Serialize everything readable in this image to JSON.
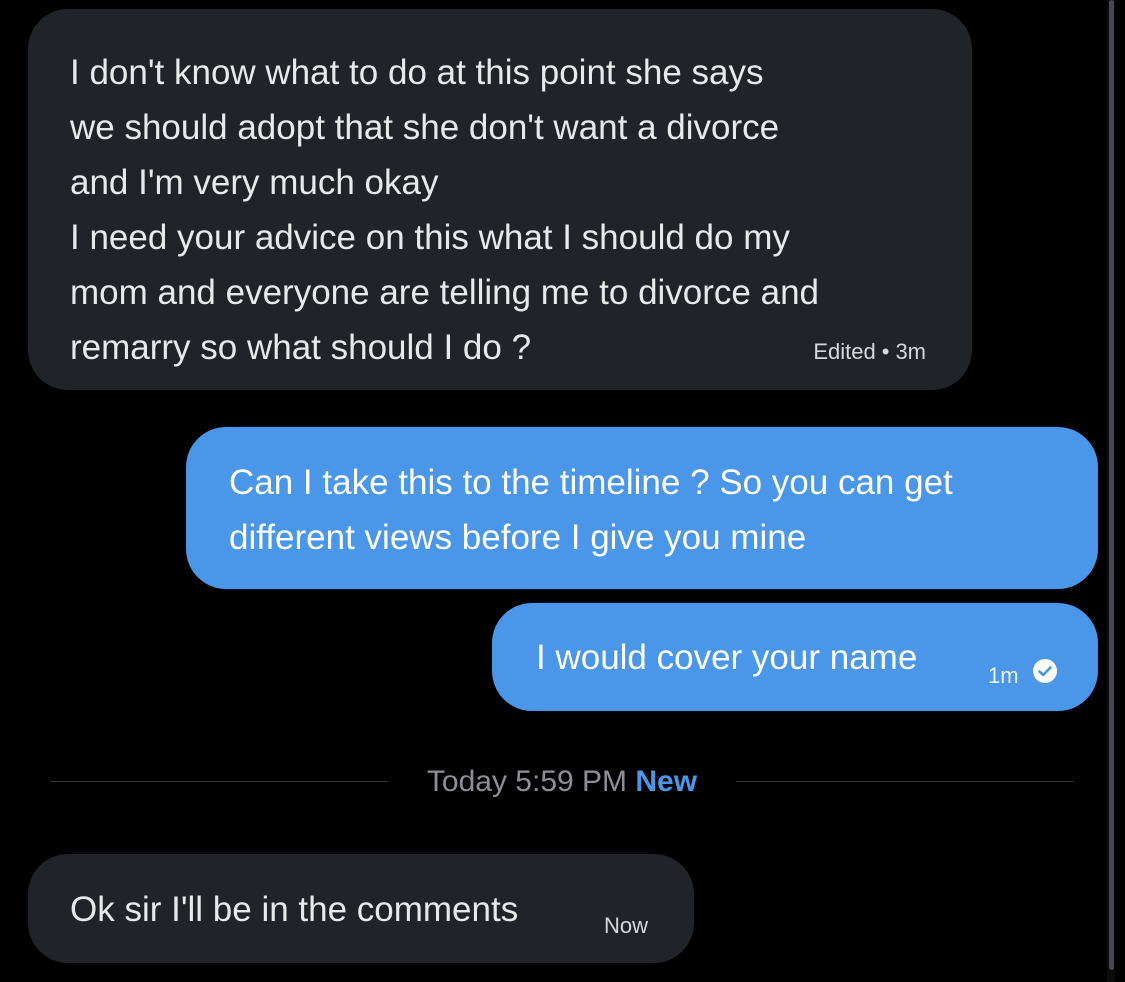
{
  "messages": [
    {
      "direction": "incoming",
      "text": "I don't know what to do at this point she says\nwe should adopt that she don't want a divorce\nand I'm very much okay\nI need your advice on this what I should do my\nmom and everyone are telling me to divorce and\nremarry so what should I do ?",
      "edited_label": "Edited",
      "separator": "•",
      "time": "3m"
    },
    {
      "direction": "outgoing",
      "text": "Can I take this to the timeline ? So you can get\ndifferent views before I give you mine"
    },
    {
      "direction": "outgoing",
      "text": "I would cover your name",
      "time": "1m",
      "status_icon": "check-circle-icon"
    }
  ],
  "divider": {
    "time_label": "Today 5:59 PM",
    "new_label": "New"
  },
  "latest_message": {
    "direction": "incoming",
    "text": "Ok sir I'll be in the comments",
    "time": "Now"
  },
  "colors": {
    "background": "#000000",
    "incoming_bubble": "#202327",
    "outgoing_bubble": "#4a96e8",
    "accent": "#4a96e8",
    "muted_text": "#8b9096"
  }
}
